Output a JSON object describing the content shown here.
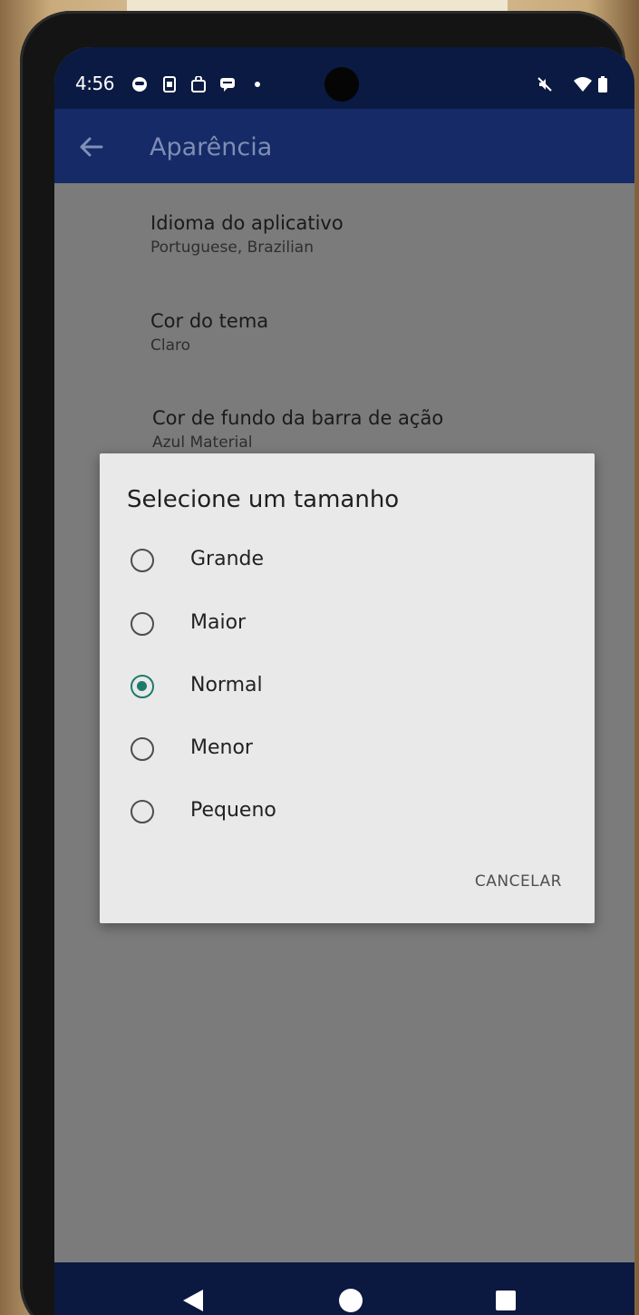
{
  "status_bar": {
    "time": "4:56",
    "icons": [
      "face-icon",
      "sim-icon",
      "bag-icon",
      "message-icon",
      "dot-icon",
      "mute-icon",
      "wifi-icon",
      "battery-icon"
    ]
  },
  "app_bar": {
    "title": "Aparência",
    "back_icon": "arrow-back-icon"
  },
  "preferences": [
    {
      "title": "Idioma do aplicativo",
      "subtitle": "Portuguese, Brazilian"
    },
    {
      "title": "Cor do tema",
      "subtitle": "Claro"
    },
    {
      "title": "Cor de fundo da barra de ação",
      "subtitle": "Azul Material"
    }
  ],
  "dialog": {
    "title": "Selecione um tamanho",
    "options": [
      {
        "label": "Grande",
        "selected": false
      },
      {
        "label": "Maior",
        "selected": false
      },
      {
        "label": "Normal",
        "selected": true
      },
      {
        "label": "Menor",
        "selected": false
      },
      {
        "label": "Pequeno",
        "selected": false
      }
    ],
    "cancel_label": "CANCELAR"
  },
  "nav_bar": {
    "buttons": [
      "back-icon",
      "home-icon",
      "recents-icon"
    ]
  },
  "colors": {
    "status_bar": "#0b1a42",
    "app_bar": "#152a66",
    "accent": "#1d7a6b",
    "dialog_bg": "#e9e9e9"
  }
}
